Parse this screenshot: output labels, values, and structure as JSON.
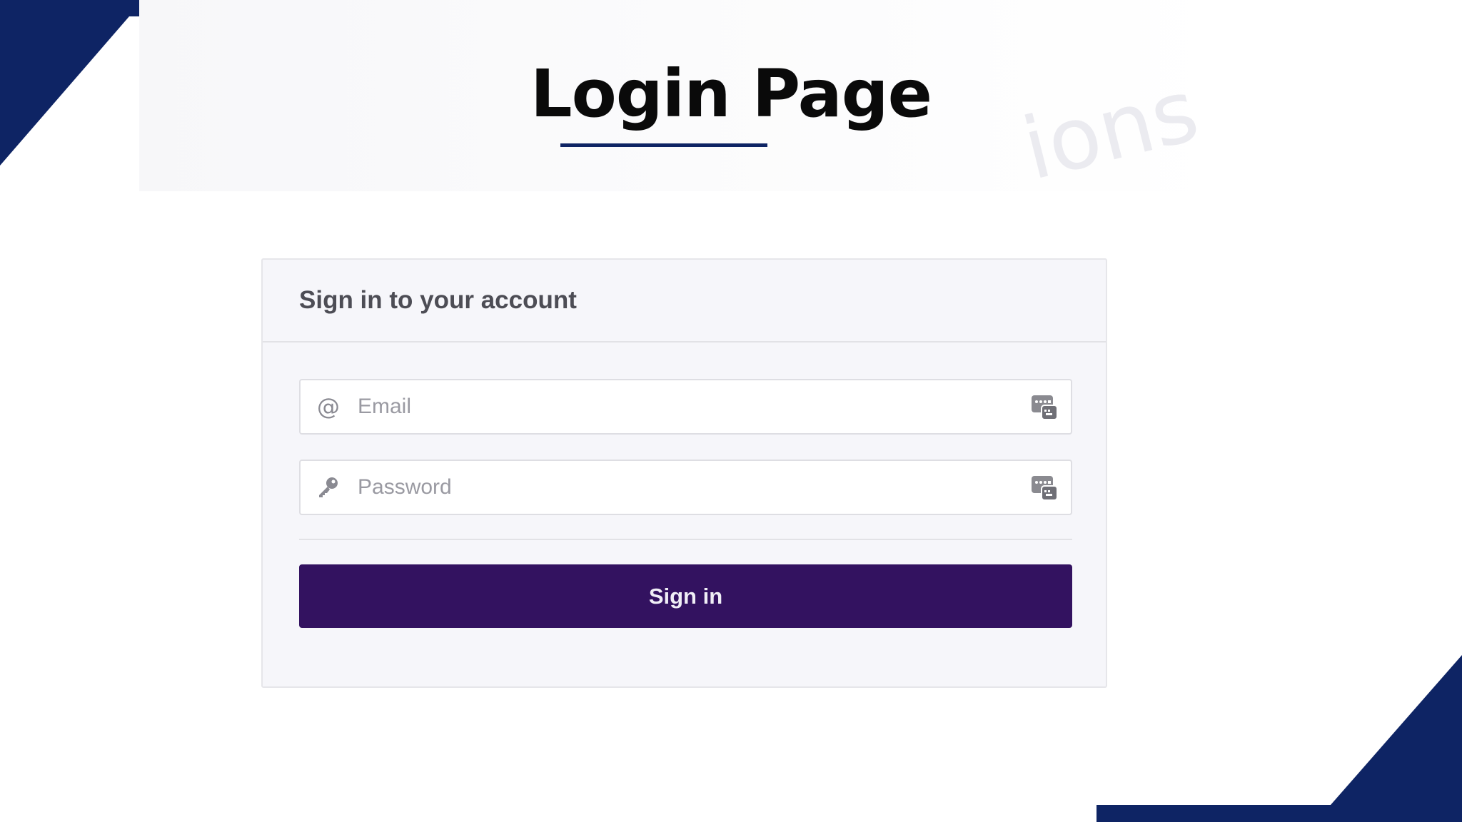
{
  "slide": {
    "title": "Login Page",
    "watermark": "ions"
  },
  "colors": {
    "navy_accent": "#0e2464",
    "button": "#331260",
    "card_background": "#f6f6fa"
  },
  "login_card": {
    "heading": "Sign in to your account",
    "email_field": {
      "placeholder": "Email",
      "value": "",
      "icon": "at-sign-icon",
      "autofill_icon": "password-manager-icon"
    },
    "password_field": {
      "placeholder": "Password",
      "value": "",
      "icon": "key-icon",
      "autofill_icon": "password-manager-icon"
    },
    "signin_label": "Sign in"
  }
}
